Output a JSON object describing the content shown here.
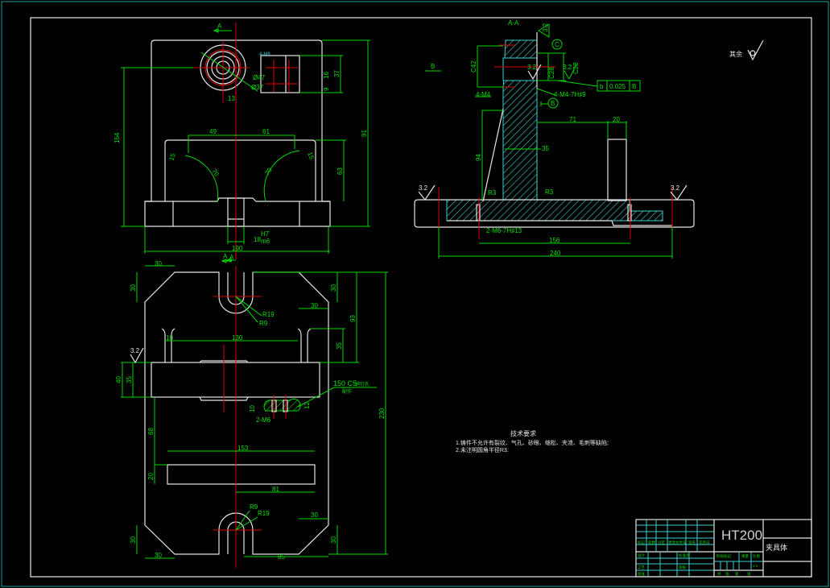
{
  "colors": {
    "background": "#000000",
    "outline": "#e6e6e6",
    "dimension": "#00d800",
    "centerline": "#e00000",
    "hatch": "#3ccfcf"
  },
  "roughness_note": {
    "label": "其余",
    "symbol": "roughness-check-icon"
  },
  "front_view": {
    "section_mark_top": "A",
    "section_mark_bottom": "A",
    "dims": {
      "d154": "154",
      "d91": "91",
      "d63": "63",
      "d190": "190",
      "d49": "49",
      "d61": "61",
      "d13": "13",
      "d37": "37",
      "d16": "16",
      "d9": "9",
      "phi47": "Ø47",
      "phi37": "Ø37",
      "r70a": "70",
      "r70b": "70",
      "d15a": "15",
      "d15b": "15",
      "fit_size": "18",
      "fit_upper": "H7",
      "fit_lower": "m6",
      "small_note": "4-M8"
    }
  },
  "top_view": {
    "section_mark": "A",
    "dims": {
      "d30_tl_h": "30",
      "d30_tl_v": "30",
      "d30_tr_h": "30",
      "d30_tr_v": "30",
      "d30_bl_h": "30",
      "d30_bl_v": "30",
      "d30_br_h": "30",
      "d30_br_v": "30",
      "r19a": "R19",
      "r9a": "R9",
      "r9b": "R9",
      "r19b": "R19",
      "d130": "130",
      "d10": "10",
      "d35a": "35",
      "d93": "93",
      "d230": "230",
      "d40": "40",
      "d35b": "35",
      "d68": "68",
      "d153": "153",
      "d20": "20",
      "d81": "81",
      "d95": "95",
      "d10b": "10",
      "d12": "12",
      "m6": "2-M6",
      "note_main": "150 C5",
      "note_sub1": "销钉孔",
      "note_sub2": "配作",
      "rough": "3.2"
    }
  },
  "section_view": {
    "title": "A-A",
    "view_b": "B",
    "dims": {
      "c42": "C42",
      "c28": "C28",
      "c28b": "C28",
      "r3a": "R3",
      "r3b": "R3",
      "d71": "71",
      "d20": "20",
      "d35": "35",
      "d94": "94",
      "d156": "156",
      "d240": "240",
      "m4a": "4-M4",
      "m4b": "4-M4-7H♯9",
      "m6": "2-M6-7H♯13",
      "rough1": "3.2",
      "rough2": "3.2",
      "rough3": "3.2",
      "rough4": "3.2",
      "rough_top": "3.2"
    },
    "datum_c": "C",
    "datum_b": "B",
    "tolerance": {
      "symbol": "b",
      "value": "0.025",
      "datum": "B"
    }
  },
  "technical_requirements": {
    "title": "技术要求",
    "items": [
      "1.铸件不允许有裂纹、气孔、砂眼、缩松、夹渣、毛刺等缺陷;",
      "2.未注明圆角半径R3."
    ]
  },
  "title_block": {
    "material": "HT200",
    "part_name": "夹具体",
    "cells": [
      "标记",
      "处数",
      "分区",
      "更改文件号",
      "签名",
      "年月日",
      "设计",
      "标准化",
      "审核",
      "工艺",
      "批准",
      "阶段标记",
      "重量",
      "比例",
      "共",
      "张",
      "第",
      "张",
      "1:1"
    ]
  }
}
